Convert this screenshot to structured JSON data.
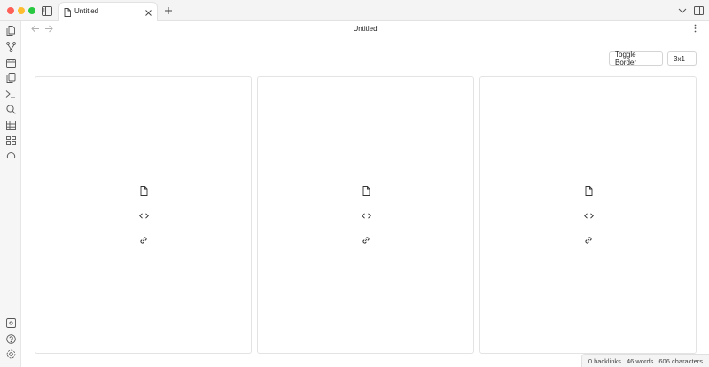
{
  "window": {
    "tab_title": "Untitled",
    "page_title": "Untitled"
  },
  "icons": {
    "sidebar_toggle": "sidebar-toggle-icon",
    "tab_doc": "file-icon",
    "tab_close": "close-icon",
    "new_tab": "plus-icon",
    "dropdown": "chevron-down-icon",
    "split_view": "split-view-icon",
    "back": "arrow-left-icon",
    "forward": "arrow-right-icon",
    "more": "more-vertical-icon"
  },
  "ribbon": {
    "top": [
      "files-icon",
      "graph-icon",
      "calendar-icon",
      "copy-icon",
      "terminal-icon",
      "search-icon",
      "table-icon",
      "dashboard-icon",
      "sync-icon"
    ],
    "bottom": [
      "vault-icon",
      "help-icon",
      "settings-icon"
    ]
  },
  "toolbar": {
    "toggle_border_label": "Toggle Border",
    "layout_label": "3x1"
  },
  "panels": [
    {
      "icons": [
        "file-icon",
        "code-icon",
        "link-icon"
      ]
    },
    {
      "icons": [
        "file-icon",
        "code-icon",
        "link-icon"
      ]
    },
    {
      "icons": [
        "file-icon",
        "code-icon",
        "link-icon"
      ]
    }
  ],
  "status": {
    "backlinks": "0 backlinks",
    "words": "46 words",
    "characters": "606 characters"
  }
}
